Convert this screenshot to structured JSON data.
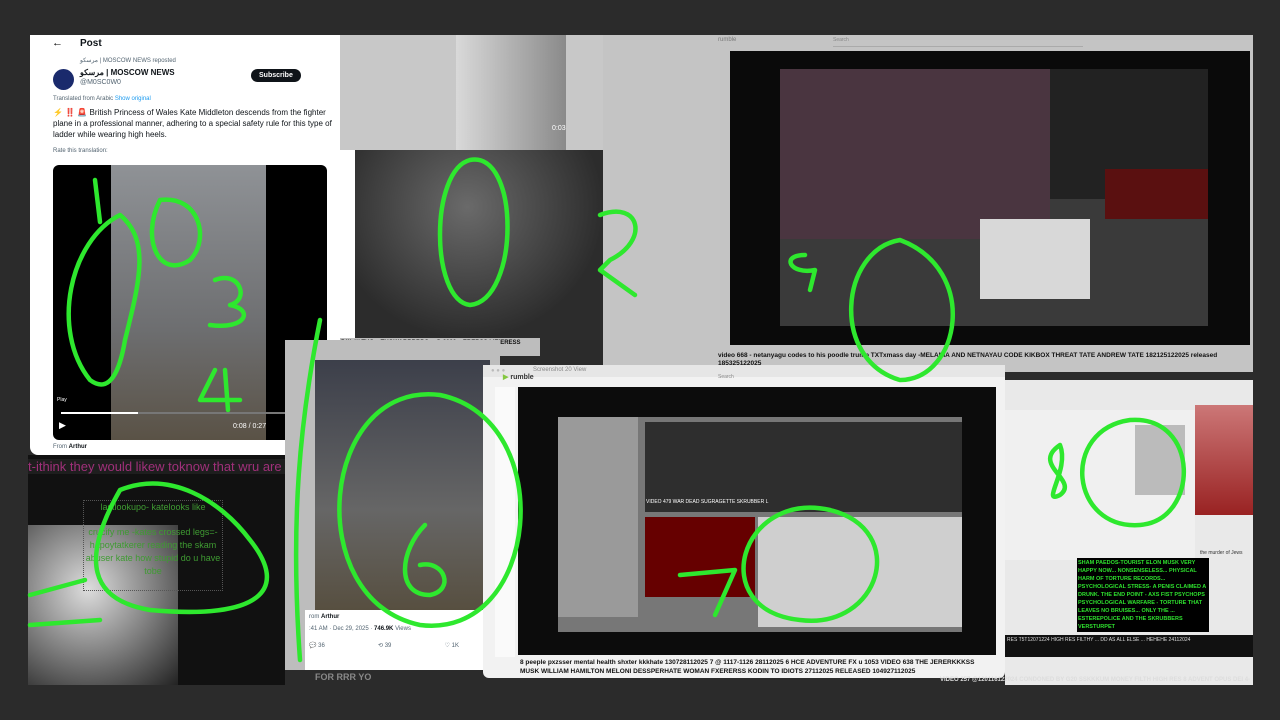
{
  "tweet": {
    "header": "Post",
    "reposted_by": "مرسكو | MOSCOW NEWS reposted",
    "display_name": "مرسكو | MOSCOW NEWS",
    "handle": "@M0SC0W0",
    "subscribe_label": "Subscribe",
    "translated_from": "Translated from Arabic",
    "show_original": "Show original",
    "text": "⚡ ‼️ 🚨 British Princess of Wales Kate Middleton descends from the fighter plane in a professional manner, adhering to a special safety rule for this type of ladder while wearing high heels.",
    "rate_translation": "Rate this translation:",
    "video": {
      "play_label": "Play",
      "time": "0:08 / 0:27",
      "progress": 0.3
    },
    "from": "From",
    "from_user": "Arthur"
  },
  "panel_caption_top": "5 ))) ((( TUO... TUOWARRRRDS... @ 2023...  ERERSS LIEIERESS WOMAN FUCKERERS",
  "top_video_time": "0:03",
  "rumble_top": {
    "logo": "rumble",
    "search_placeholder": "Search",
    "caption": "video 668 - netanyagu codes to his poodle trump TXTxmass day -MELANIA AND NETNAYAU CODE KIKBOX THREAT TATE ANDREW TATE 182125122025 released 185325122025"
  },
  "left_bottom": {
    "banner": "t-ithink they would likew toknow that wru are sik twisted",
    "lines": [
      "lastlookupo- katelooks like",
      "crucify me -kates crossed legs=- hapoytatkerer reading the skam abuser kate how stupid do u have tobe"
    ]
  },
  "tweet2": {
    "from": "rom",
    "from_user": "Arthur",
    "meta": ":41 AM · Dec 29, 2025 · ",
    "views": "746.9K",
    "views_label": "Views",
    "replies": "36",
    "reposts": "39",
    "likes": "1K",
    "below": "FOR RRR YO"
  },
  "rumble_window": {
    "title": "Screenshot 20",
    "view_label": "View",
    "logo": "rumble",
    "search_placeholder": "Search",
    "caption": "8 peeple pxzsser mental health shxter kkkhate 130728112025 7 @ 1117-1126 28112025 6 HCE ADVENTURE FX u 1053 VIDEO 638 THE JERERKKKSS MUSK WILLIAM HAMILTON MELONI DESSPERHATE WOMAN FXERERSS KODIN TO IDIOTS 27112025 RELEASED 104927112025",
    "inner_caption": "VIDEO 479 WAR DEAD SUGRAGETTE SKRUBBER L"
  },
  "right_panel": {
    "green_text": "SHAM PAEDOS-TOURIST ELON MUSK VERY HAPPY NOW... NONSENSELESS... PHYSICAL HARM OF TORTURE RECORDS... PSYCHOLOGICAL STRESS- A PENIS CLAIMED A DRUNK. THE END POINT - AXS FIST PSYCHOPS PSYCHOLOGICAL WARFARE - TORTURE THAT LEAVES NO BRUISES... ONLY THE ... ESTEREPOLICE AND THE SKRUBBERS VERSTURPET",
    "caption": "RES T5T12071224 HIGH RES FILTHY ... DD AS ALL ELSE ... HEHEHE 24112024",
    "side_text": "the murder of Jews",
    "bottom_caption": "VIDEO 257 @120116122024 CONDONED BY G20 SSKKKUM MONEY FILTH HIGH RES 8 ADVENT OPUS DEI 4-"
  },
  "colors": {
    "marker": "#2ee82e",
    "rumble_green": "#85c742",
    "subscribe_bg": "#0f1419",
    "link": "#1d9bf0"
  },
  "annotations": [
    "1",
    "2",
    "3",
    "4",
    "5",
    "6",
    "7",
    "8"
  ]
}
